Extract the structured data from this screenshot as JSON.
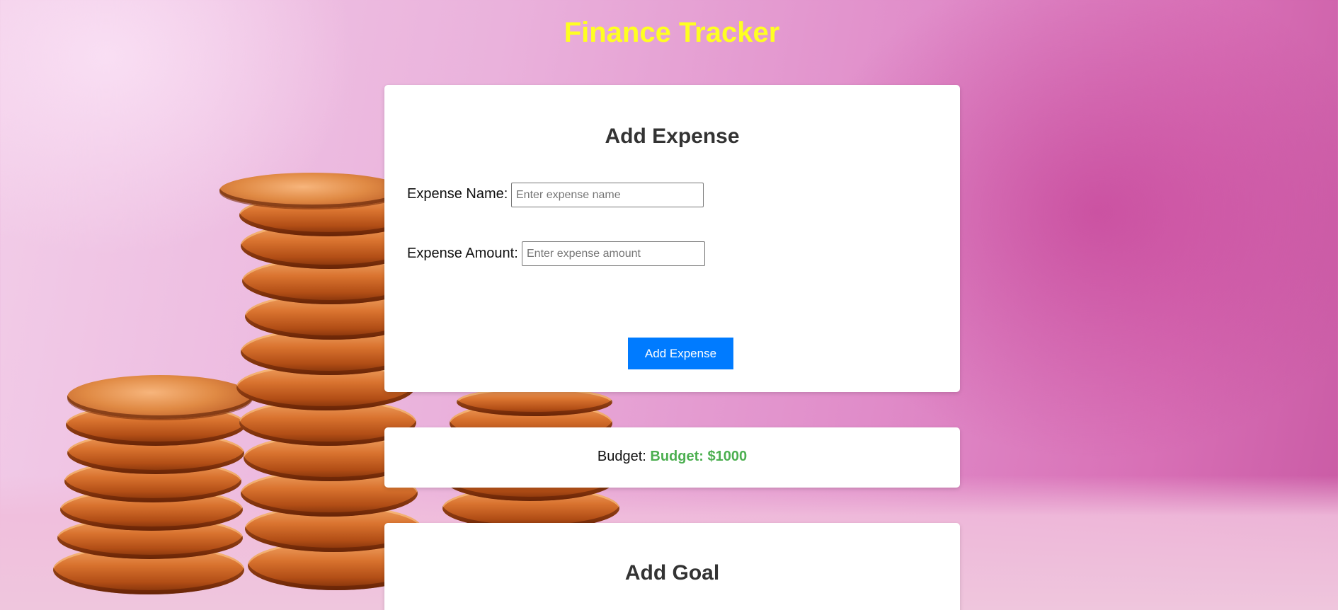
{
  "app": {
    "title": "Finance Tracker"
  },
  "add_expense": {
    "heading": "Add Expense",
    "name_label": "Expense Name:",
    "name_placeholder": "Enter expense name",
    "amount_label": "Expense Amount:",
    "amount_placeholder": "Enter expense amount",
    "button_label": "Add Expense"
  },
  "budget": {
    "label": "Budget:",
    "value": "Budget: $1000"
  },
  "add_goal": {
    "heading": "Add Goal"
  },
  "colors": {
    "title": "#ffff22",
    "button": "#007bff",
    "budget_value": "#4caf50"
  }
}
